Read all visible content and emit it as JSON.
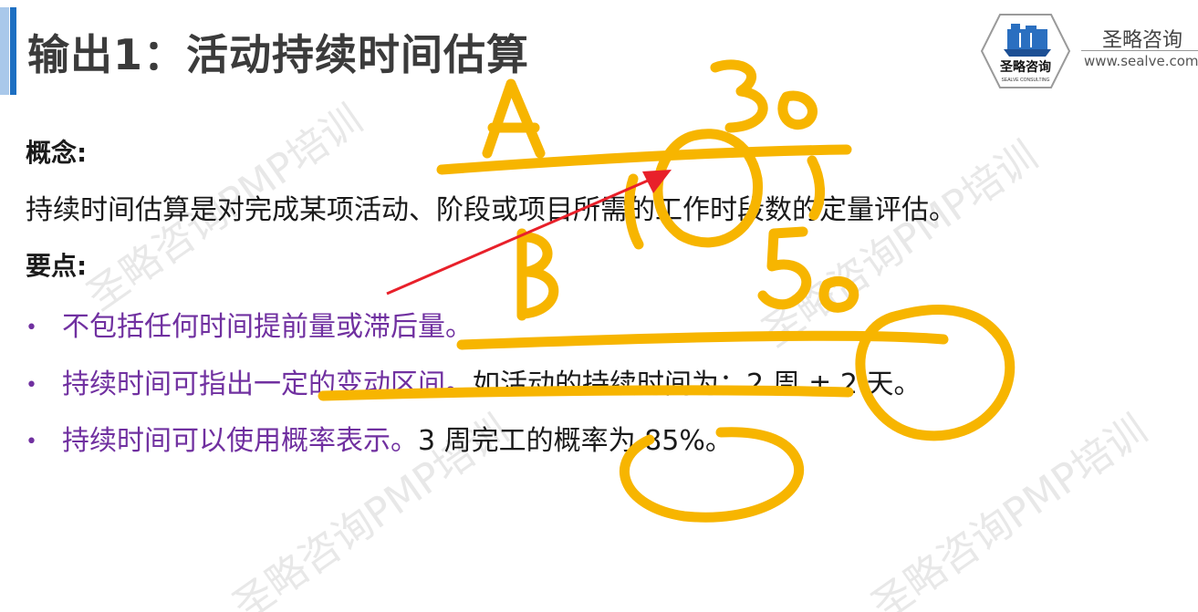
{
  "slide": {
    "title": "输出1：活动持续时间估算",
    "logo": {
      "badge_text": "圣略咨询",
      "badge_subtext": "SEALVE CONSULTING",
      "name": "圣略咨询",
      "url": "www.sealve.com"
    },
    "concept": {
      "heading": "概念:",
      "text": "持续时间估算是对完成某项活动、阶段或项目所需的工作时段数的定量评估。"
    },
    "key_points": {
      "heading": "要点:",
      "bullets": [
        {
          "dot": "•",
          "purple": "不包括任何时间提前量或滞后量。",
          "black": ""
        },
        {
          "dot": "•",
          "purple": "持续时间可指出一定的变动区间。",
          "black": "如活动的持续时间为：2 周 ± 2 天。"
        },
        {
          "dot": "•",
          "purple": "持续时间可以使用概率表示。",
          "black": "3 周完工的概率为 85%。"
        }
      ]
    },
    "watermark": "圣略咨询PMP培训",
    "annotation": {
      "label_a": "A",
      "label_b": "B",
      "number_1": "30",
      "number_2": "50",
      "ink_color": "#f7b500",
      "arrow_color": "#e8202a"
    },
    "colors": {
      "accent_blue": "#1d6fc2",
      "purple_text": "#7030a0"
    }
  }
}
